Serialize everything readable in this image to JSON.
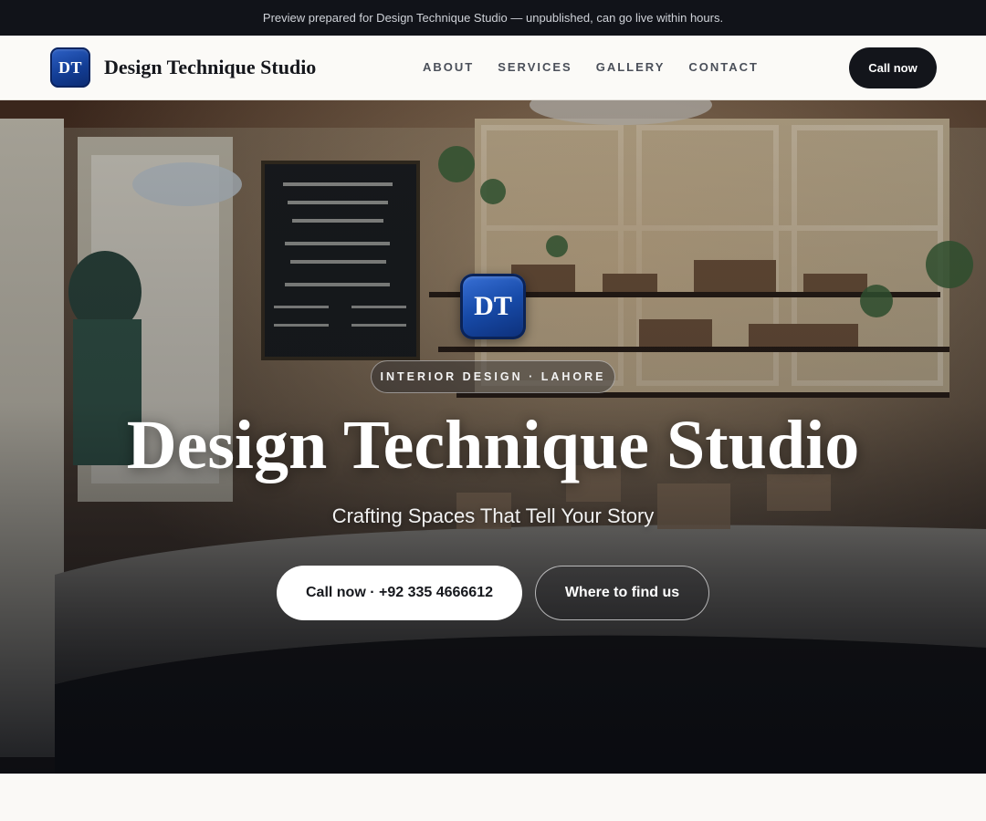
{
  "banner": {
    "text": "Preview prepared for Design Technique Studio — unpublished, can go live within hours."
  },
  "header": {
    "logo_text": "DT",
    "brand_name": "Design Technique Studio",
    "nav": [
      {
        "label": "ABOUT"
      },
      {
        "label": "SERVICES"
      },
      {
        "label": "GALLERY"
      },
      {
        "label": "CONTACT"
      }
    ],
    "call_label": "Call now"
  },
  "hero": {
    "background_description_icon": "cafe-interior-photo",
    "logo_text": "DT",
    "tag": "INTERIOR DESIGN · LAHORE",
    "title": "Design Technique Studio",
    "subtitle": "Crafting Spaces That Tell Your Story",
    "primary_button": "Call now · +92 335 4666612",
    "secondary_button": "Where to find us"
  },
  "colors": {
    "dark": "#111319",
    "brand_blue": "#174aa8",
    "page_bg": "#faf9f6"
  }
}
